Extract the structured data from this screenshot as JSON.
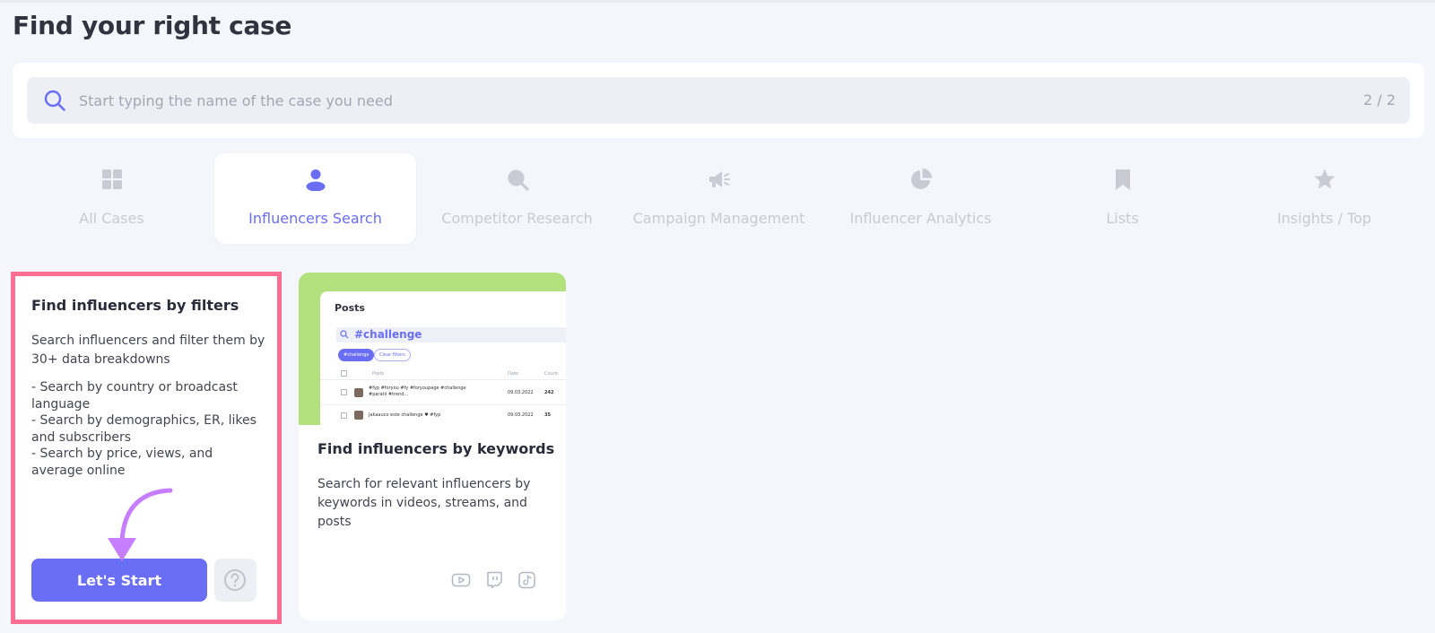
{
  "page": {
    "title": "Find your right case"
  },
  "search": {
    "placeholder": "Start typing the name of the case you need",
    "count": "2 / 2"
  },
  "tabs": [
    {
      "label": "All Cases",
      "icon": "grid-icon",
      "active": false
    },
    {
      "label": "Influencers Search",
      "icon": "user-icon",
      "active": true
    },
    {
      "label": "Competitor Research",
      "icon": "search-icon",
      "active": false
    },
    {
      "label": "Campaign Management",
      "icon": "megaphone-icon",
      "active": false
    },
    {
      "label": "Influencer Analytics",
      "icon": "pie-chart-icon",
      "active": false
    },
    {
      "label": "Lists",
      "icon": "bookmark-icon",
      "active": false
    },
    {
      "label": "Insights / Top",
      "icon": "star-icon",
      "active": false
    }
  ],
  "cards": [
    {
      "title": "Find influencers by filters",
      "description": "Search influencers and filter them by 30+ data breakdowns",
      "bullets": [
        "- Search by country or broadcast language",
        "- Search by demographics, ER, likes and subscribers",
        "- Search by price, views, and average online"
      ],
      "button_label": "Let's Start"
    },
    {
      "title": "Find influencers by keywords",
      "description": "Search for relevant influencers by keywords in videos, streams, and posts",
      "preview": {
        "section_title": "Posts",
        "search_value": "#challenge",
        "chips": [
          "#challenge",
          "Clear filters"
        ],
        "columns": [
          "Posts",
          "Date",
          "Count"
        ],
        "rows": [
          {
            "text": "#fyp #foryou #fy #foryoupage #challenge #paratii #trend...",
            "date": "09.03.2022",
            "count": "242"
          },
          {
            "text": "Jakaauco este challenge ♥ #fyp",
            "date": "09.03.2022",
            "count": "35"
          }
        ]
      },
      "platform_icons": [
        "youtube-icon",
        "twitch-icon",
        "tiktok-icon"
      ]
    }
  ],
  "colors": {
    "accent": "#6a6ef5",
    "highlight_border": "#ff6d93",
    "arrow": "#c77dff",
    "preview_bg": "#b3e17e"
  }
}
